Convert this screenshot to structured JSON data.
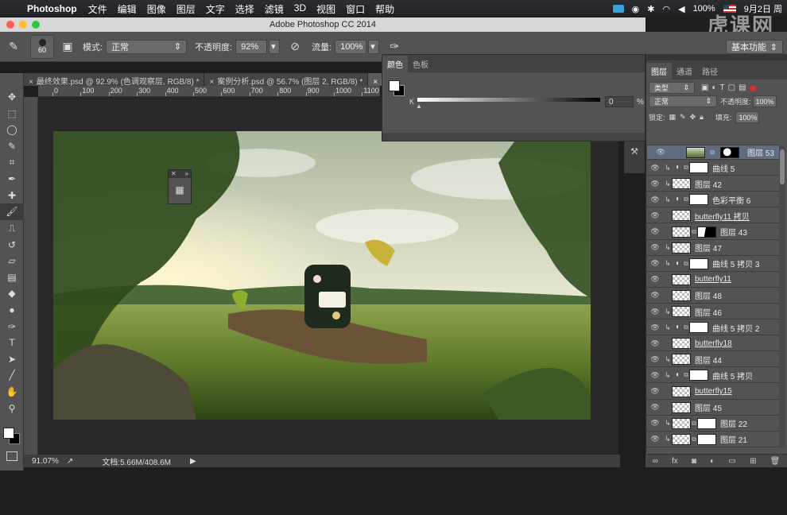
{
  "menubar": {
    "app_name": "Photoshop",
    "items": [
      "文件",
      "编辑",
      "图像",
      "图层",
      "文字",
      "选择",
      "滤镜",
      "3D",
      "视图",
      "窗口",
      "帮助"
    ],
    "battery": "100%",
    "date": "9月2日 周",
    "watermark": "虎课网"
  },
  "window": {
    "title": "Adobe Photoshop CC 2014"
  },
  "options": {
    "brush_size": "60",
    "mode_label": "模式:",
    "mode_value": "正常",
    "opacity_label": "不透明度:",
    "opacity_value": "92%",
    "flow_label": "流量:",
    "flow_value": "100%",
    "workspace": "基本功能"
  },
  "tabs": [
    {
      "label": "最终效果.psd @ 92.9% (色调观察层, RGB/8) *",
      "active": false
    },
    {
      "label": "案例分析.psd @ 56.7% (图层 2, RGB/8) *",
      "active": false
    },
    {
      "label": "案",
      "active": true
    }
  ],
  "ruler": {
    "ticks": [
      "0",
      "100",
      "200",
      "300",
      "400",
      "500",
      "600",
      "700",
      "800",
      "900",
      "1000",
      "1100"
    ]
  },
  "status": {
    "zoom": "91.07%",
    "doc": "文档:5.66M/408.6M"
  },
  "color_panel": {
    "tabs": [
      "颜色",
      "色板"
    ],
    "channel": "K",
    "value": "0",
    "unit": "%",
    "fg_color": "#ffffff",
    "bg_color": "#000000"
  },
  "layers_panel": {
    "tabs": [
      "图层",
      "通道",
      "路径"
    ],
    "filter": "类型",
    "blend": "正常",
    "opacity_label": "不透明度:",
    "opacity": "100%",
    "lock_label": "锁定:",
    "fill_label": "填充:",
    "fill": "100%",
    "layers": [
      {
        "name": "图层 53",
        "thumb": "photo",
        "mask": "mask2",
        "adj": false,
        "clip": false,
        "selected": true,
        "underline": false
      },
      {
        "name": "曲线 5",
        "thumb": "adj",
        "mask": "white",
        "adj": true,
        "clip": true,
        "selected": false,
        "underline": false
      },
      {
        "name": "图层 42",
        "thumb": "trans",
        "mask": "",
        "adj": false,
        "clip": true,
        "selected": false,
        "underline": false
      },
      {
        "name": "色彩平衡 6",
        "thumb": "adj",
        "mask": "white",
        "adj": true,
        "clip": true,
        "selected": false,
        "underline": false
      },
      {
        "name": "butterfly11 拷贝",
        "thumb": "smart",
        "mask": "",
        "adj": false,
        "clip": false,
        "selected": false,
        "underline": true
      },
      {
        "name": "图层 43",
        "thumb": "trans",
        "mask": "mask",
        "adj": false,
        "clip": false,
        "selected": false,
        "underline": false
      },
      {
        "name": "图层 47",
        "thumb": "trans",
        "mask": "",
        "adj": false,
        "clip": true,
        "selected": false,
        "underline": false
      },
      {
        "name": "曲线 5 拷贝 3",
        "thumb": "adj",
        "mask": "white",
        "adj": true,
        "clip": true,
        "selected": false,
        "underline": false
      },
      {
        "name": "butterfly11",
        "thumb": "smart",
        "mask": "",
        "adj": false,
        "clip": false,
        "selected": false,
        "underline": true
      },
      {
        "name": "图层 48",
        "thumb": "trans",
        "mask": "",
        "adj": false,
        "clip": false,
        "selected": false,
        "underline": false
      },
      {
        "name": "图层 46",
        "thumb": "trans",
        "mask": "",
        "adj": false,
        "clip": true,
        "selected": false,
        "underline": false
      },
      {
        "name": "曲线 5 拷贝 2",
        "thumb": "adj",
        "mask": "white",
        "adj": true,
        "clip": true,
        "selected": false,
        "underline": false
      },
      {
        "name": "butterfly18",
        "thumb": "smart",
        "mask": "",
        "adj": false,
        "clip": false,
        "selected": false,
        "underline": true
      },
      {
        "name": "图层 44",
        "thumb": "trans",
        "mask": "",
        "adj": false,
        "clip": true,
        "selected": false,
        "underline": false
      },
      {
        "name": "曲线 5 拷贝",
        "thumb": "adj",
        "mask": "white",
        "adj": true,
        "clip": true,
        "selected": false,
        "underline": false
      },
      {
        "name": "butterfly15",
        "thumb": "smart",
        "mask": "",
        "adj": false,
        "clip": false,
        "selected": false,
        "underline": true
      },
      {
        "name": "图层 45",
        "thumb": "trans",
        "mask": "",
        "adj": false,
        "clip": false,
        "selected": false,
        "underline": false
      },
      {
        "name": "图层 22",
        "thumb": "trans",
        "mask": "white",
        "adj": false,
        "clip": true,
        "selected": false,
        "underline": false
      },
      {
        "name": "图层 21",
        "thumb": "trans",
        "mask": "white",
        "adj": false,
        "clip": true,
        "selected": false,
        "underline": false
      }
    ]
  },
  "tools": [
    "move-icon",
    "marquee-icon",
    "lasso-icon",
    "quick-select-icon",
    "crop-icon",
    "eyedropper-icon",
    "healing-icon",
    "brush-icon",
    "stamp-icon",
    "history-brush-icon",
    "eraser-icon",
    "gradient-icon",
    "blur-icon",
    "dodge-icon",
    "pen-icon",
    "type-icon",
    "path-select-icon",
    "shape-icon",
    "hand-icon",
    "zoom-icon"
  ],
  "colors": {
    "accent_selected_layer": "#5f6d80",
    "ui_bg": "#535353"
  }
}
